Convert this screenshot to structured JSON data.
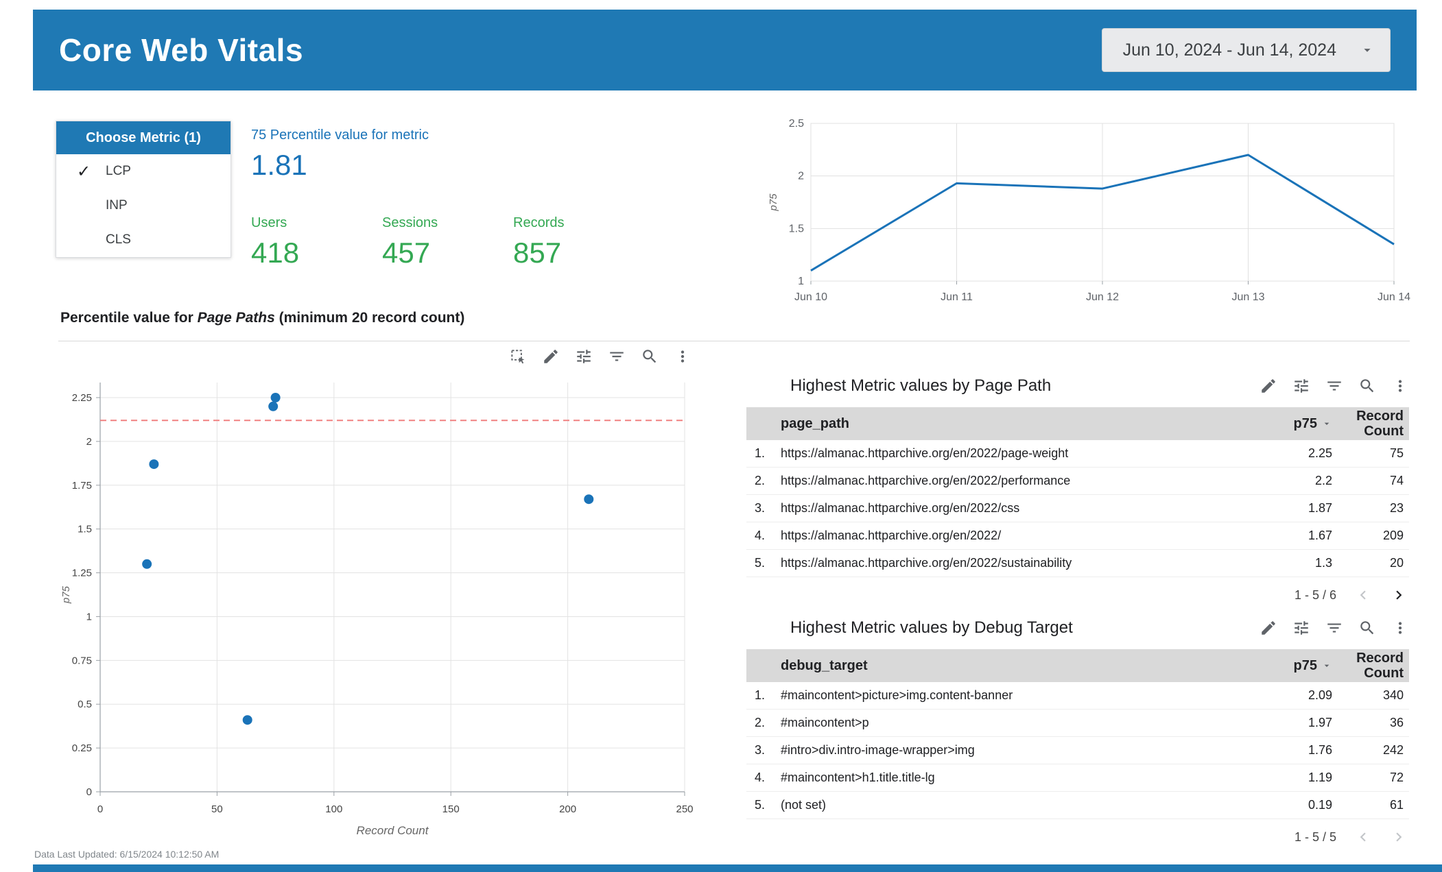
{
  "header": {
    "title": "Core Web Vitals",
    "date_range": "Jun 10, 2024 - Jun 14, 2024"
  },
  "metric_selector": {
    "title": "Choose Metric (1)",
    "options": [
      {
        "label": "LCP",
        "selected": true
      },
      {
        "label": "INP",
        "selected": false
      },
      {
        "label": "CLS",
        "selected": false
      }
    ]
  },
  "scorecards": {
    "percentile": {
      "label": "75 Percentile value for metric",
      "value": "1.81"
    },
    "users": {
      "label": "Users",
      "value": "418"
    },
    "sessions": {
      "label": "Sessions",
      "value": "457"
    },
    "records": {
      "label": "Records",
      "value": "857"
    }
  },
  "section": {
    "prefix": "Percentile value for ",
    "italic": "Page Paths",
    "suffix": " (minimum 20 record count)"
  },
  "chart_data": [
    {
      "type": "line",
      "title": "p75 over time",
      "x": [
        "Jun 10",
        "Jun 11",
        "Jun 12",
        "Jun 13",
        "Jun 14"
      ],
      "series": [
        {
          "name": "p75",
          "values": [
            1.1,
            1.93,
            1.88,
            2.2,
            1.35
          ]
        }
      ],
      "xlabel": "",
      "ylabel": "p75",
      "ylim": [
        1,
        2.5
      ],
      "yticks": [
        1,
        1.5,
        2,
        2.5
      ],
      "grid": true,
      "legend": "none",
      "line_color": "#1a73b8"
    },
    {
      "type": "scatter",
      "title": "Percentile value for Page Paths (minimum 20 record count)",
      "xlabel": "Record Count",
      "ylabel": "p75",
      "xlim": [
        0,
        250
      ],
      "ylim": [
        0,
        2.25
      ],
      "xticks": [
        0,
        50,
        100,
        150,
        200,
        250
      ],
      "yticks": [
        0,
        0.25,
        0.5,
        0.75,
        1,
        1.25,
        1.5,
        1.75,
        2,
        2.25
      ],
      "points": [
        [
          75,
          2.25
        ],
        [
          74,
          2.2
        ],
        [
          23,
          1.87
        ],
        [
          209,
          1.67
        ],
        [
          20,
          1.3
        ],
        [
          63,
          0.41
        ]
      ],
      "threshold_y": 2.12,
      "grid": true,
      "point_color": "#1a73b8",
      "threshold_color": "#f08080"
    }
  ],
  "toolbars": {
    "scatter": [
      "marquee-select",
      "edit",
      "tune",
      "filter",
      "zoom",
      "more-options"
    ],
    "table": [
      "edit",
      "tune",
      "filter",
      "zoom",
      "more-options"
    ]
  },
  "tables": [
    {
      "title": "Highest Metric values by Page Path",
      "columns": [
        "page_path",
        "p75",
        "Record Count"
      ],
      "rows": [
        [
          "1.",
          "https://almanac.httparchive.org/en/2022/page-weight",
          "2.25",
          "75"
        ],
        [
          "2.",
          "https://almanac.httparchive.org/en/2022/performance",
          "2.2",
          "74"
        ],
        [
          "3.",
          "https://almanac.httparchive.org/en/2022/css",
          "1.87",
          "23"
        ],
        [
          "4.",
          "https://almanac.httparchive.org/en/2022/",
          "1.67",
          "209"
        ],
        [
          "5.",
          "https://almanac.httparchive.org/en/2022/sustainability",
          "1.3",
          "20"
        ]
      ],
      "pagination": "1 - 5 / 6",
      "prev_enabled": false,
      "next_enabled": true
    },
    {
      "title": "Highest Metric values by Debug Target",
      "columns": [
        "debug_target",
        "p75",
        "Record Count"
      ],
      "rows": [
        [
          "1.",
          "#maincontent>picture>img.content-banner",
          "2.09",
          "340"
        ],
        [
          "2.",
          "#maincontent>p",
          "1.97",
          "36"
        ],
        [
          "3.",
          "#intro>div.intro-image-wrapper>img",
          "1.76",
          "242"
        ],
        [
          "4.",
          "#maincontent>h1.title.title-lg",
          "1.19",
          "72"
        ],
        [
          "5.",
          "(not set)",
          "0.19",
          "61"
        ]
      ],
      "pagination": "1 - 5 / 5",
      "prev_enabled": false,
      "next_enabled": false
    }
  ],
  "footer": {
    "last_updated": "Data Last Updated: 6/15/2024 10:12:50 AM"
  },
  "colors": {
    "header_blue": "#1f79b4",
    "accent_blue": "#1a73b8",
    "green": "#34a853",
    "threshold_red": "#f08080",
    "table_header_gray": "#d9d9d9"
  }
}
